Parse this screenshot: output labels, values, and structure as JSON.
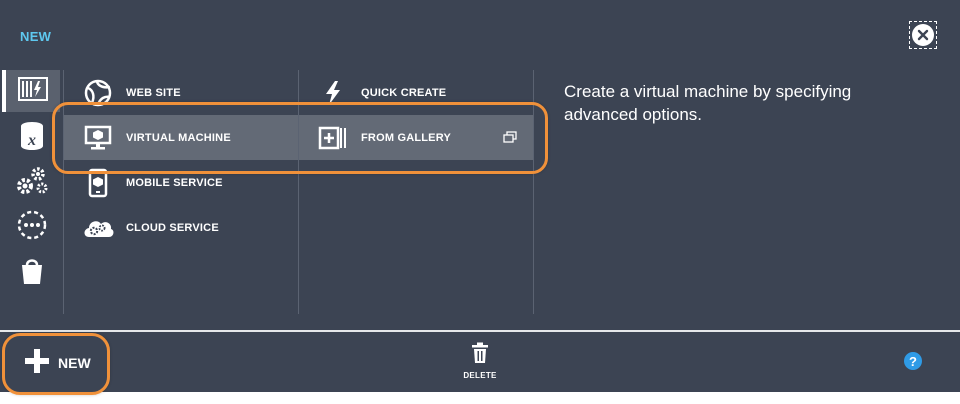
{
  "header": {
    "title": "NEW",
    "close_icon": "close-icon"
  },
  "rail": {
    "items": [
      {
        "name": "compute",
        "icon": "compute-icon",
        "selected": true
      },
      {
        "name": "data-services",
        "icon": "data-icon",
        "selected": false
      },
      {
        "name": "app-services",
        "icon": "gears-icon",
        "selected": false
      },
      {
        "name": "network-services",
        "icon": "network-icon",
        "selected": false
      },
      {
        "name": "store",
        "icon": "store-icon",
        "selected": false
      }
    ]
  },
  "column1": {
    "items": [
      {
        "label": "WEB SITE",
        "icon": "web-site-icon"
      },
      {
        "label": "VIRTUAL MACHINE",
        "icon": "virtual-machine-icon",
        "selected": true
      },
      {
        "label": "MOBILE SERVICE",
        "icon": "mobile-service-icon"
      },
      {
        "label": "CLOUD SERVICE",
        "icon": "cloud-service-icon"
      }
    ]
  },
  "column2": {
    "items": [
      {
        "label": "QUICK CREATE",
        "icon": "lightning-icon"
      },
      {
        "label": "FROM GALLERY",
        "icon": "gallery-icon",
        "selected": true,
        "ext_icon": "open-dialog-icon"
      }
    ]
  },
  "description": "Create a virtual machine by specifying advanced options.",
  "command_bar": {
    "new_label": "NEW",
    "delete_label": "DELETE",
    "help_label": "?"
  },
  "colors": {
    "panel_bg": "#3c4453",
    "accent_title": "#5ec8ef",
    "selection_bg": "#636a76",
    "highlight": "#f0913a",
    "help": "#2f9be6"
  }
}
